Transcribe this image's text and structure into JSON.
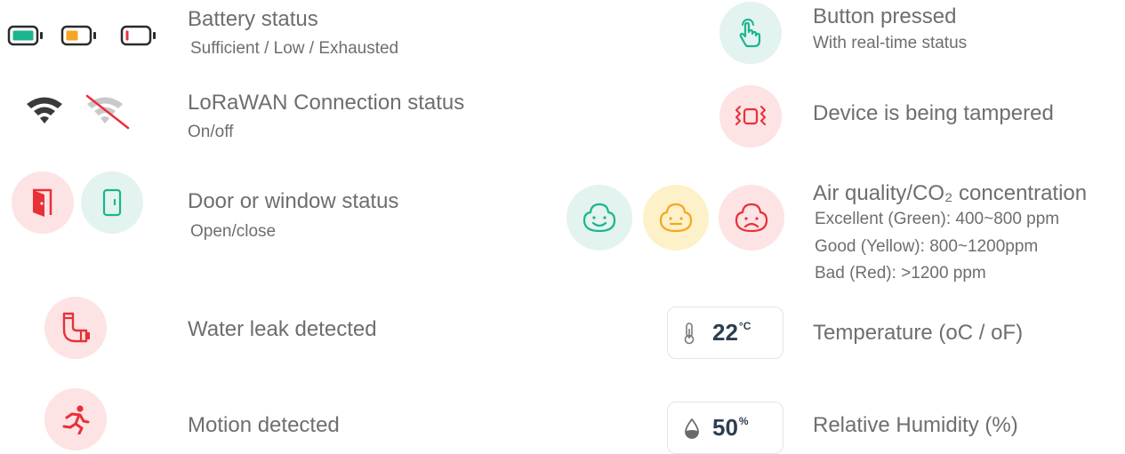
{
  "colors": {
    "accent_green": "#1bb58f",
    "accent_orange": "#f5a623",
    "accent_red": "#e8303a",
    "bg_pink": "#fde3e3",
    "bg_mint": "#e3f3ef",
    "bg_yellow": "#fdf1c9",
    "text": "#6e6e6e"
  },
  "left": {
    "battery": {
      "title": "Battery status",
      "sub": "Sufficient / Low / Exhausted",
      "icons": [
        "battery-full-icon",
        "battery-low-icon",
        "battery-empty-icon"
      ]
    },
    "lorawan": {
      "title": "LoRaWAN Connection status",
      "sub": "On/off",
      "icons": [
        "wifi-icon",
        "wifi-off-icon"
      ]
    },
    "door": {
      "title": "Door or window status",
      "sub": "Open/close",
      "icons": [
        "door-open-icon",
        "door-closed-icon"
      ]
    },
    "leak": {
      "title": "Water leak detected",
      "icons": [
        "pipe-leak-icon"
      ]
    },
    "motion": {
      "title": "Motion detected",
      "icons": [
        "running-person-icon"
      ]
    }
  },
  "right": {
    "button": {
      "title": "Button pressed",
      "sub": "With real-time status",
      "icons": [
        "hand-tap-icon"
      ]
    },
    "tamper": {
      "title": "Device is being tampered",
      "icons": [
        "vibration-icon"
      ]
    },
    "air": {
      "title": "Air quality/CO₂ concentration",
      "lines": [
        "Excellent (Green): 400~800 ppm",
        "Good (Yellow): 800~1200ppm",
        "Bad (Red): >1200 ppm"
      ],
      "icons": [
        "face-happy-icon",
        "face-neutral-icon",
        "face-sad-icon"
      ]
    },
    "temperature": {
      "title": "Temperature (oC / oF)",
      "value": "22",
      "unit": "°C",
      "icons": [
        "thermometer-icon"
      ]
    },
    "humidity": {
      "title": "Relative Humidity (%)",
      "value": "50",
      "unit": "%",
      "icons": [
        "droplet-icon"
      ]
    }
  }
}
